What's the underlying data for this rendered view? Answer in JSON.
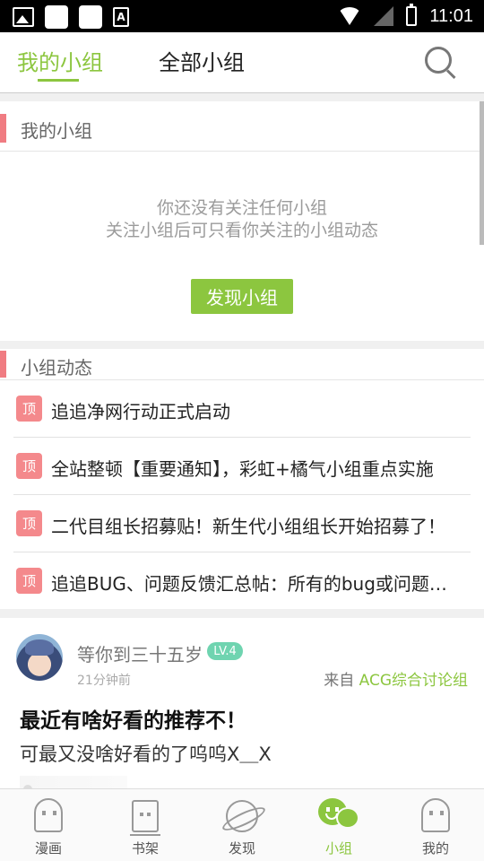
{
  "status_bar": {
    "time": "11:01",
    "icons": [
      "image-icon",
      "square-icon",
      "square-icon",
      "font-icon",
      "wifi-icon",
      "signal-off-icon",
      "battery-charging-icon"
    ]
  },
  "top_tabs": {
    "active": "我的小组",
    "tabs": [
      {
        "label": "我的小组"
      },
      {
        "label": "全部小组"
      }
    ],
    "search_icon": "search-icon"
  },
  "my_groups": {
    "title": "我的小组",
    "empty_line1": "你还没有关注任何小组",
    "empty_line2": "关注小组后可只看你关注的小组动态",
    "discover_button": "发现小组"
  },
  "group_feed": {
    "title": "小组动态",
    "pinned": [
      {
        "badge": "顶",
        "text": "追追净网行动正式启动"
      },
      {
        "badge": "顶",
        "text": "全站整顿【重要通知】，彩虹+橘气小组重点实施"
      },
      {
        "badge": "顶",
        "text": "二代目组长招募贴！新生代小组组长开始招募了！"
      },
      {
        "badge": "顶",
        "text": "追追BUG、问题反馈汇总帖：所有的bug或问题…"
      }
    ]
  },
  "post": {
    "username": "等你到三十五岁",
    "level": "LV.4",
    "time": "21分钟前",
    "from_prefix": "来自 ",
    "group_name": "ACG综合讨论组",
    "title": "最近有啥好看的推荐不！",
    "body": "可最又没啥好看的了呜呜X＿X"
  },
  "bottom_nav": {
    "active": "小组",
    "items": [
      {
        "label": "漫画",
        "icon": "comic-ghost-icon"
      },
      {
        "label": "书架",
        "icon": "bookshelf-icon"
      },
      {
        "label": "发现",
        "icon": "planet-icon"
      },
      {
        "label": "小组",
        "icon": "group-chat-icon"
      },
      {
        "label": "我的",
        "icon": "profile-ghost-icon"
      }
    ]
  },
  "colors": {
    "accent_green": "#8cc63f",
    "pin_red": "#f4898c",
    "level_teal": "#6fd4b0"
  }
}
